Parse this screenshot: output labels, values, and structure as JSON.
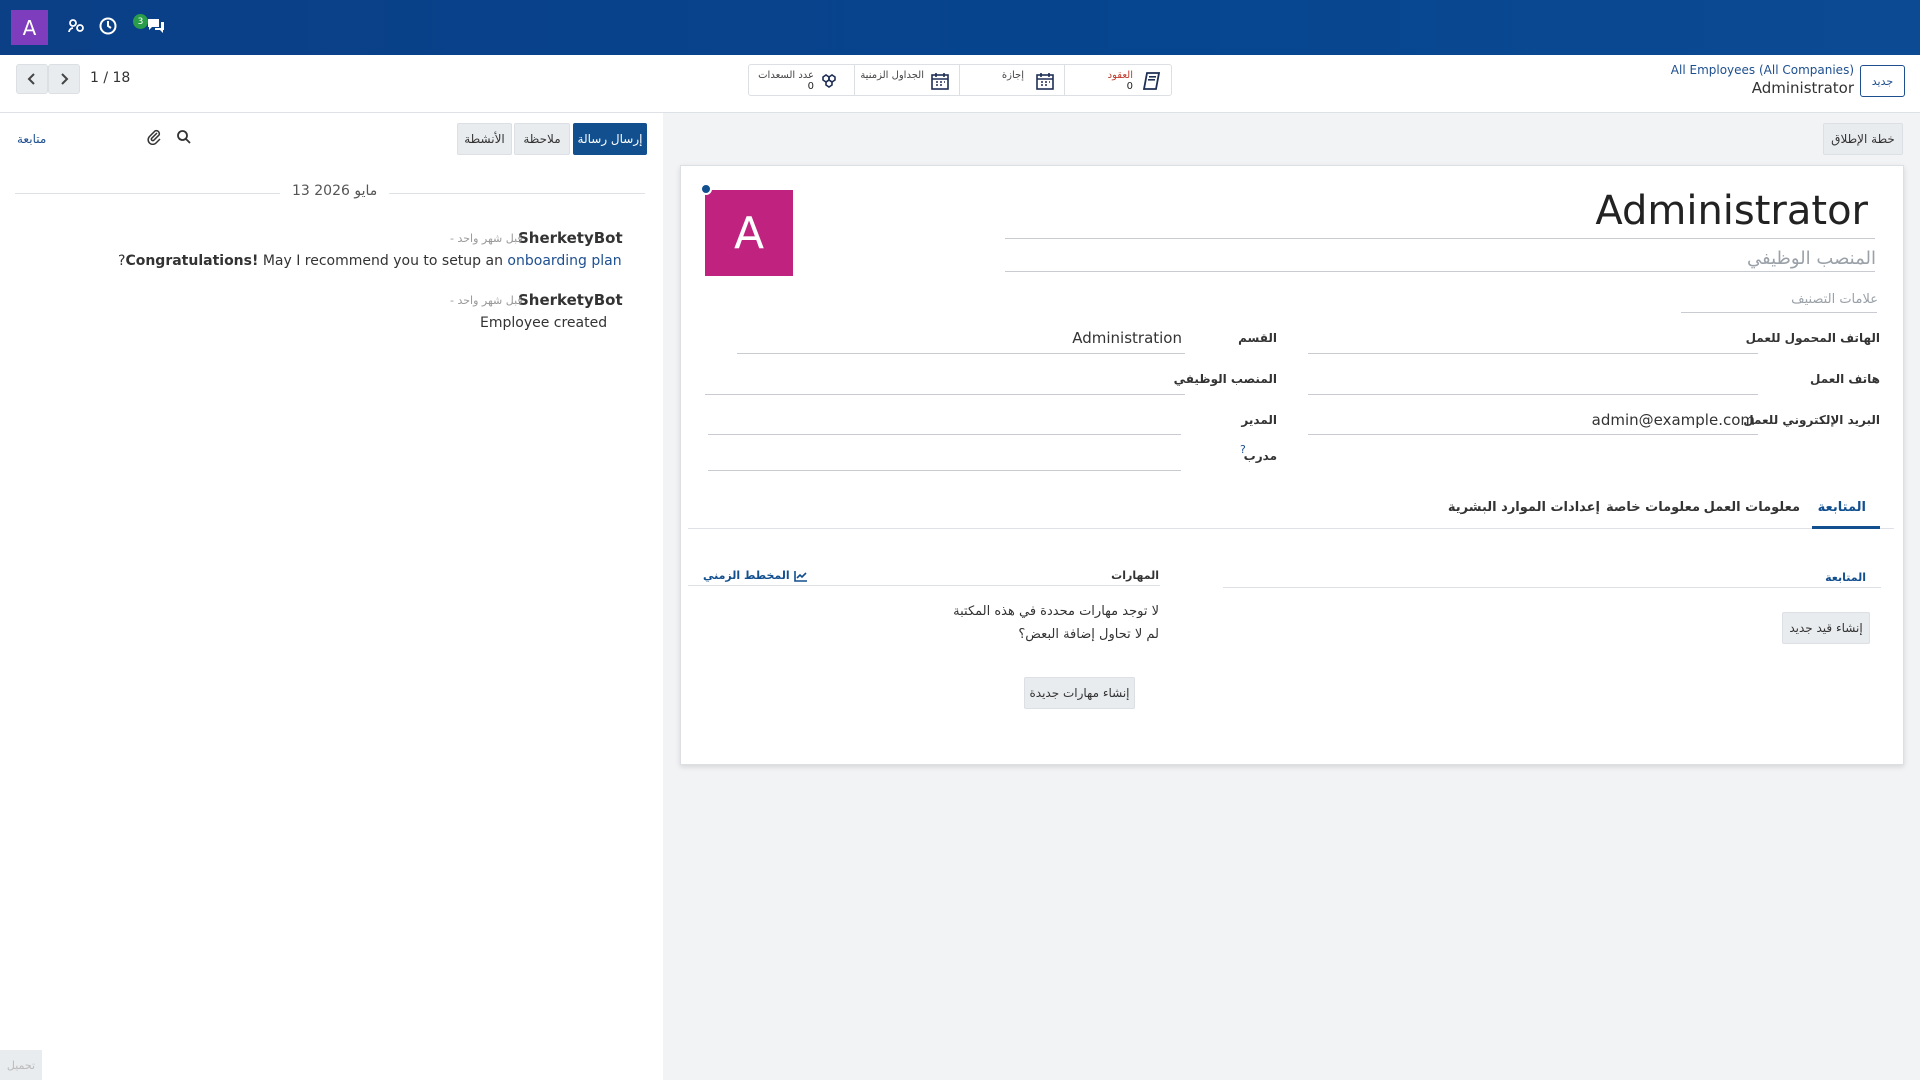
{
  "navbar": {
    "avatar_letter": "A",
    "icons": [
      "users-gear-icon",
      "clock-icon",
      "chat-icon"
    ],
    "chat_badge": "3",
    "color": "#0b3f86"
  },
  "control": {
    "pager": "1 / 18",
    "breadcrumb_parent": "All Employees (All Companies)",
    "breadcrumb_current": "Administrator",
    "new_label": "جديد",
    "smart_buttons": [
      {
        "label": "العقود",
        "value": "0",
        "icon": "book-icon"
      },
      {
        "label": "إجازة",
        "value": "",
        "icon": "calendar-icon"
      },
      {
        "label": "الجداول الزمنية",
        "value": "",
        "icon": "calendar-icon"
      },
      {
        "label": "عدد السعدات",
        "value": "0",
        "icon": "cubes-icon"
      }
    ]
  },
  "chatter": {
    "send_message": "إرسال رسالة",
    "log_note": "ملاحظة",
    "activities": "الأنشطة",
    "follow": "متابعة",
    "date": "13 مايو 2026",
    "messages": [
      {
        "author": "SherketyBot",
        "time": "- قبل شهر واحد",
        "body_pre": "?",
        "body_bold": "Congratulations!",
        "body_mid": " May I recommend you to setup an ",
        "body_link": "onboarding plan"
      },
      {
        "author": "SherketyBot",
        "time": "- قبل شهر واحد",
        "body": "Employee created"
      }
    ],
    "load_more": "تحميل"
  },
  "form": {
    "launch_plan": "خطة الإطلاق",
    "avatar_letter": "A",
    "name": "Administrator",
    "job_title_placeholder": "المنصب الوظيفي",
    "tags_placeholder": "علامات التصنيف",
    "fields": {
      "mobile_label": "الهاتف المحمول للعمل",
      "work_phone_label": "هاتف العمل",
      "work_email_label": "البريد الإلكتروني للعمل",
      "work_email_value": "admin@example.com",
      "department_label": "القسم",
      "department_value": "Administration",
      "job_position_label": "المنصب الوظيفي",
      "manager_label": "المدير",
      "coach_label": "مدرب",
      "coach_help": "?"
    },
    "tabs": [
      "المتابعة",
      "معلومات العمل",
      "معلومات خاصة",
      "إعدادات الموارد البشرية"
    ],
    "resume": {
      "title": "المتابعة",
      "create_button": "إنشاء قيد جديد"
    },
    "skills": {
      "title": "المهارات",
      "chart_label": "المخطط الزمني",
      "empty_line1": "لا توجد مهارات محددة في هذه المكتبة",
      "empty_line2": "لم لا تحاول إضافة البعض؟",
      "create_button": "إنشاء مهارات جديدة"
    }
  }
}
